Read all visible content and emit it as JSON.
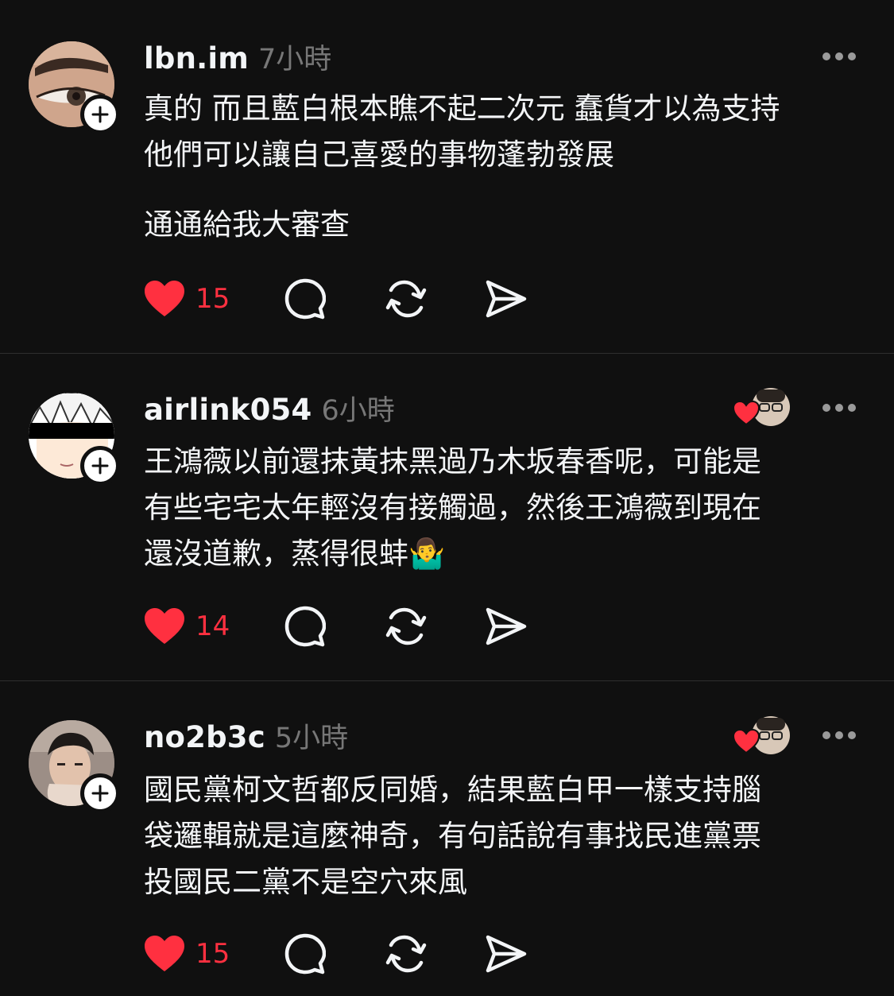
{
  "accent": "#ff3040",
  "posts": [
    {
      "username": "lbn.im",
      "time": "7小時",
      "avatar": "eye-closeup-avatar",
      "text_paragraphs": [
        "真的 而且藍白根本瞧不起二次元 蠢貨才以為支持\n他們可以讓自己喜愛的事物蓬勃發展",
        "通通給我大審查"
      ],
      "likes": "15",
      "liked": true,
      "liked_by_author": false
    },
    {
      "username": "airlink054",
      "time": "6小時",
      "avatar": "anime-face-avatar",
      "text_paragraphs": [
        "王鴻薇以前還抹黃抹黑過乃木坂春香呢，可能是\n有些宅宅太年輕沒有接觸過，然後王鴻薇到現在\n還沒道歉，蒸得很蚌🤷‍♂️"
      ],
      "likes": "14",
      "liked": true,
      "liked_by_author": true
    },
    {
      "username": "no2b3c",
      "time": "5小時",
      "avatar": "person-photo-avatar",
      "text_paragraphs": [
        "國民黨柯文哲都反同婚，結果藍白甲一樣支持腦\n袋邏輯就是這麼神奇，有句話說有事找民進黨票\n投國民二黨不是空穴來風"
      ],
      "likes": "15",
      "liked": true,
      "liked_by_author": true
    }
  ]
}
